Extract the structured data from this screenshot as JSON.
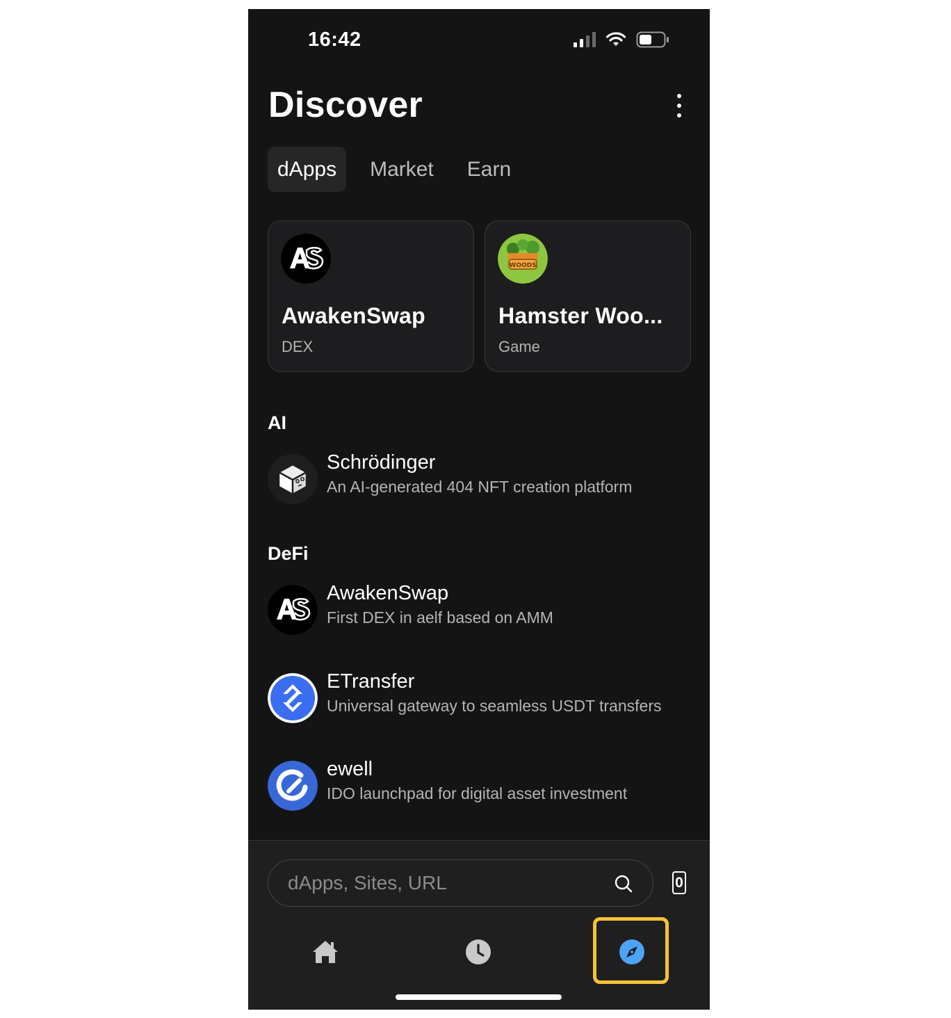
{
  "status_bar": {
    "time": "16:42"
  },
  "header": {
    "title": "Discover"
  },
  "tabs": [
    {
      "label": "dApps",
      "active": true
    },
    {
      "label": "Market",
      "active": false
    },
    {
      "label": "Earn",
      "active": false
    }
  ],
  "featured": [
    {
      "name": "AwakenSwap",
      "category": "DEX",
      "icon": "awakenswap-logo"
    },
    {
      "name": "Hamster Woo...",
      "category": "Game",
      "icon": "hamster-woods-logo"
    }
  ],
  "sections": [
    {
      "title": "AI",
      "items": [
        {
          "name": "Schrödinger",
          "description": "An AI-generated 404 NFT creation platform",
          "icon": "schrodinger-logo"
        }
      ]
    },
    {
      "title": "DeFi",
      "items": [
        {
          "name": "AwakenSwap",
          "description": "First DEX in aelf based on AMM",
          "icon": "awakenswap-logo"
        },
        {
          "name": "ETransfer",
          "description": "Universal gateway to seamless USDT transfers",
          "icon": "etransfer-logo"
        },
        {
          "name": "ewell",
          "description": "IDO launchpad for digital asset investment",
          "icon": "ewell-logo"
        }
      ]
    }
  ],
  "search": {
    "placeholder": "dApps, Sites, URL",
    "value": ""
  },
  "open_tabs_count": "0",
  "bottom_nav": [
    {
      "icon": "home-icon",
      "active": false
    },
    {
      "icon": "clock-icon",
      "active": false
    },
    {
      "icon": "compass-icon",
      "active": true
    }
  ],
  "colors": {
    "background": "#141415",
    "card": "#1d1d1f",
    "highlight": "#f5c435",
    "accent": "#4ea3f7"
  }
}
